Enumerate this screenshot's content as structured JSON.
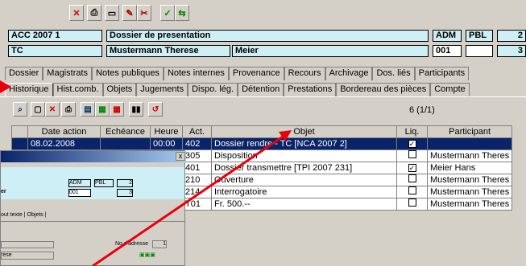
{
  "toolbar": {
    "b1": "✕",
    "b2": "⎙",
    "b3": "▭",
    "b4": "✎",
    "b5": "✂",
    "b6": "✓",
    "b7": "⇆"
  },
  "header": {
    "row1": {
      "code": "ACC 2007 1",
      "title": "Dossier de presentation",
      "c1": "ADM",
      "c2": "PBL",
      "c3": "2"
    },
    "row2": {
      "code": "TC",
      "name": "Mustermann Therese",
      "name2": "Meier",
      "c1": "001",
      "c2": "",
      "c3": "3"
    }
  },
  "tabs_row1": [
    "Dossier",
    "Magistrats",
    "Notes publiques",
    "Notes internes",
    "Provenance",
    "Recours",
    "Archivage",
    "Dos. liés",
    "Participants"
  ],
  "tabs_row2": [
    "Historique",
    "Hist.comb.",
    "Objets",
    "Jugements",
    "Dispo. lég.",
    "Détention",
    "Prestations",
    "Bordereau des pièces",
    "Compte"
  ],
  "count": "6 (1/1)",
  "grid": {
    "headers": [
      "",
      "Date action",
      "Echéance",
      "Heure",
      "Act.",
      "Objet",
      "Liq.",
      "Participant"
    ],
    "rows": [
      {
        "date": "08.02.2008",
        "ech": "",
        "heure": "00:00",
        "act": "402",
        "objet": "Dossier rendre - TC [NCA 2007 2]",
        "liq": "✓",
        "part": ""
      },
      {
        "date": "",
        "ech": "",
        "heure": "",
        "act": "305",
        "objet": "Disposition",
        "liq": "",
        "part": "Mustermann Theres"
      },
      {
        "date": "",
        "ech": "",
        "heure": "",
        "act": "401",
        "objet": "Dossier transmettre [TPI 2007 231]",
        "liq": "✓",
        "part": "Meier Hans"
      },
      {
        "date": "",
        "ech": "",
        "heure": "",
        "act": "210",
        "objet": "Ouverture",
        "liq": "",
        "part": "Mustermann Theres"
      },
      {
        "date": "",
        "ech": "",
        "heure": "",
        "act": "214",
        "objet": "Interrogatoire",
        "liq": "",
        "part": "Mustermann Theres"
      },
      {
        "date": "",
        "ech": "",
        "heure": "",
        "act": "T01",
        "objet": "Fr. 500.--",
        "liq": "",
        "part": "Mustermann Theres"
      }
    ]
  },
  "subwin": {
    "close": "x",
    "c1": "ADM",
    "c2": "PBL",
    "c3": "2",
    "c4": "001",
    "c5": "3",
    "name_frag": "er",
    "tabs": "out texte | Objets |",
    "adr_label": "No d'adresse",
    "adr_val": "1",
    "frag2": "rese"
  },
  "colors": {
    "accent": "#cfeff7",
    "selected": "#0a246a",
    "arrow": "#e8000b"
  }
}
